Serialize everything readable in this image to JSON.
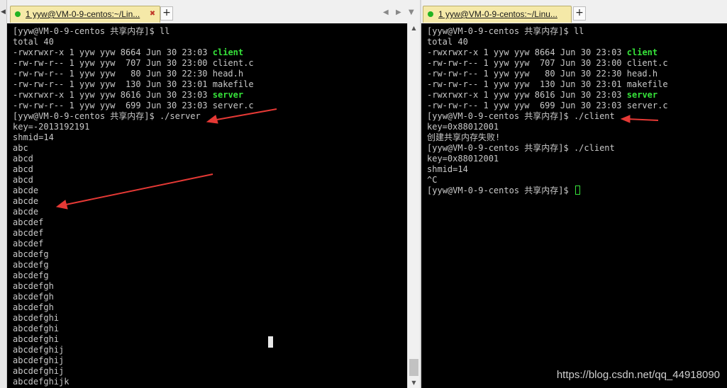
{
  "left_pane": {
    "tab": {
      "title": "1 yyw@VM-0-9-centos:~/Lin..."
    },
    "lines": [
      [
        {
          "t": "[yyw@VM-0-9-centos 共享内存]$ ll"
        }
      ],
      [
        {
          "t": "total 40"
        }
      ],
      [
        {
          "t": "-rwxrwxr-x 1 yyw yyw 8664 Jun 30 23:03 "
        },
        {
          "t": "client",
          "c": "g"
        }
      ],
      [
        {
          "t": "-rw-rw-r-- 1 yyw yyw  707 Jun 30 23:00 client.c"
        }
      ],
      [
        {
          "t": "-rw-rw-r-- 1 yyw yyw   80 Jun 30 22:30 head.h"
        }
      ],
      [
        {
          "t": "-rw-rw-r-- 1 yyw yyw  130 Jun 30 23:01 makefile"
        }
      ],
      [
        {
          "t": "-rwxrwxr-x 1 yyw yyw 8616 Jun 30 23:03 "
        },
        {
          "t": "server",
          "c": "g"
        }
      ],
      [
        {
          "t": "-rw-rw-r-- 1 yyw yyw  699 Jun 30 23:03 server.c"
        }
      ],
      [
        {
          "t": "[yyw@VM-0-9-centos 共享内存]$ ./server"
        }
      ],
      [
        {
          "t": "key=-2013192191"
        }
      ],
      [
        {
          "t": "shmid=14"
        }
      ],
      [
        {
          "t": "abc"
        }
      ],
      [
        {
          "t": "abcd"
        }
      ],
      [
        {
          "t": "abcd"
        }
      ],
      [
        {
          "t": "abcd"
        }
      ],
      [
        {
          "t": "abcde"
        }
      ],
      [
        {
          "t": "abcde"
        }
      ],
      [
        {
          "t": "abcde"
        }
      ],
      [
        {
          "t": "abcdef"
        }
      ],
      [
        {
          "t": "abcdef"
        }
      ],
      [
        {
          "t": "abcdef"
        }
      ],
      [
        {
          "t": "abcdefg"
        }
      ],
      [
        {
          "t": "abcdefg"
        }
      ],
      [
        {
          "t": "abcdefg"
        }
      ],
      [
        {
          "t": "abcdefgh"
        }
      ],
      [
        {
          "t": "abcdefgh"
        }
      ],
      [
        {
          "t": "abcdefgh"
        }
      ],
      [
        {
          "t": "abcdefghi"
        }
      ],
      [
        {
          "t": "abcdefghi"
        }
      ],
      [
        {
          "t": "abcdefghi"
        }
      ],
      [
        {
          "t": "abcdefghij"
        }
      ],
      [
        {
          "t": "abcdefghij"
        }
      ],
      [
        {
          "t": "abcdefghij"
        }
      ],
      [
        {
          "t": "abcdefghijk"
        }
      ]
    ]
  },
  "right_pane": {
    "tab": {
      "title": "1 yyw@VM-0-9-centos:~/Linu..."
    },
    "lines": [
      [
        {
          "t": "[yyw@VM-0-9-centos 共享内存]$ ll"
        }
      ],
      [
        {
          "t": "total 40"
        }
      ],
      [
        {
          "t": "-rwxrwxr-x 1 yyw yyw 8664 Jun 30 23:03 "
        },
        {
          "t": "client",
          "c": "g"
        }
      ],
      [
        {
          "t": "-rw-rw-r-- 1 yyw yyw  707 Jun 30 23:00 client.c"
        }
      ],
      [
        {
          "t": "-rw-rw-r-- 1 yyw yyw   80 Jun 30 22:30 head.h"
        }
      ],
      [
        {
          "t": "-rw-rw-r-- 1 yyw yyw  130 Jun 30 23:01 makefile"
        }
      ],
      [
        {
          "t": "-rwxrwxr-x 1 yyw yyw 8616 Jun 30 23:03 "
        },
        {
          "t": "server",
          "c": "g"
        }
      ],
      [
        {
          "t": "-rw-rw-r-- 1 yyw yyw  699 Jun 30 23:03 server.c"
        }
      ],
      [
        {
          "t": "[yyw@VM-0-9-centos 共享内存]$ ./client"
        }
      ],
      [
        {
          "t": "key=0x88012001"
        }
      ],
      [
        {
          "t": "创建共享内存失败!"
        }
      ],
      [
        {
          "t": "[yyw@VM-0-9-centos 共享内存]$ ./client"
        }
      ],
      [
        {
          "t": "key=0x88012001"
        }
      ],
      [
        {
          "t": "shmid=14"
        }
      ],
      [
        {
          "t": "^C"
        }
      ],
      [
        {
          "t": "[yyw@VM-0-9-centos 共享内存]$ "
        },
        {
          "t": "",
          "c": "cursor"
        }
      ]
    ]
  },
  "icons": {
    "tab_status": "green-dot-icon",
    "tab_close": "close-icon",
    "add_tab": "plus-icon",
    "nav_prev": "triangle-left-icon",
    "nav_next": "triangle-right-icon",
    "tab_menu": "triangle-down-icon"
  },
  "colors": {
    "terminal_bg": "#000000",
    "terminal_fg": "#c8c8c8",
    "executable": "#36e23a",
    "tab_active": "#f5e9a8",
    "annotation_arrow": "#e53935"
  },
  "watermark": "https://blog.csdn.net/qq_44918090"
}
